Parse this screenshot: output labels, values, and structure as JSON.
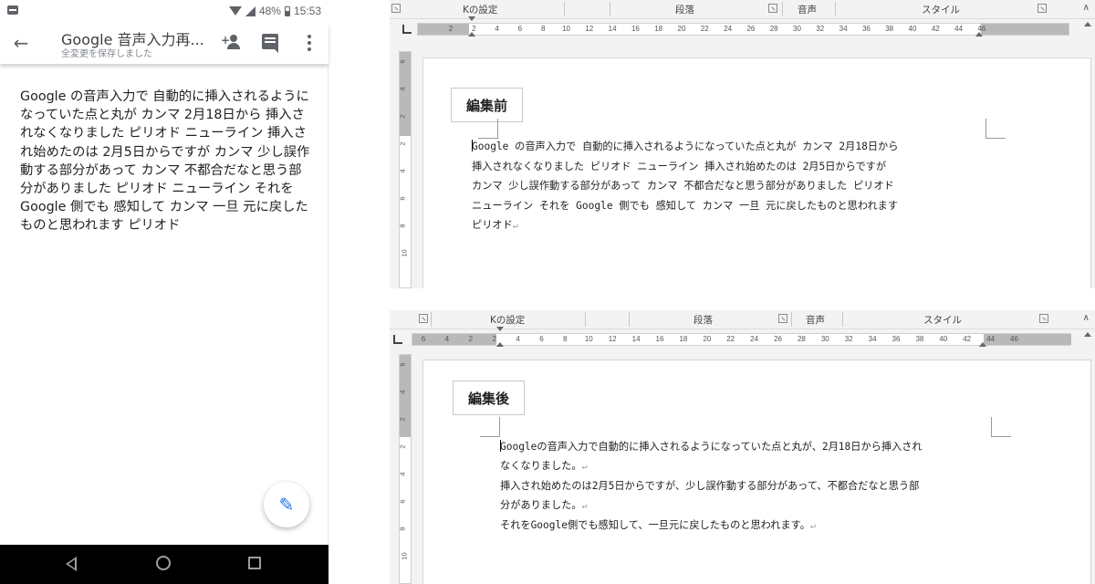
{
  "phone": {
    "status": {
      "battery": "48%",
      "time": "15:53"
    },
    "appbar": {
      "back_icon": "arrow-back-icon",
      "title": "Google 音声入力再...",
      "subtitle": "全変更を保存しました",
      "actions": [
        "person-add-icon",
        "comment-icon",
        "more-vert-icon"
      ]
    },
    "body_text": "Google の音声入力で 自動的に挿入されるようになっていた点と丸が カンマ 2月18日から 挿入されなくなりました ピリオド ニューライン 挿入され始めたのは 2月5日からですが カンマ 少し誤作動する部分があって カンマ 不都合だなと思う部分がありました ピリオド ニューライン それを Google 側でも 感知して カンマ 一旦 元に戻したものと思われます ピリオド",
    "fab_icon": "edit-pencil-icon",
    "navbar": [
      "nav-back-icon",
      "nav-home-icon",
      "nav-recent-icon"
    ],
    "accent_color": "#1a73e8"
  },
  "word_top": {
    "ribbon": {
      "group1": "Kの設定",
      "group2": "段落",
      "group3": "音声",
      "group4": "スタイル"
    },
    "ruler_ticks": [
      "2",
      "2",
      "4",
      "6",
      "8",
      "10",
      "12",
      "14",
      "16",
      "18",
      "20",
      "22",
      "24",
      "26",
      "28",
      "30",
      "32",
      "34",
      "36",
      "38",
      "40",
      "42",
      "44",
      "46"
    ],
    "vruler_ticks": [
      "6",
      "4",
      "2",
      "2",
      "4",
      "6",
      "8",
      "10"
    ],
    "label": "編集前",
    "lines": [
      "Google の音声入力で 自動的に挿入されるようになっていた点と丸が カンマ 2月18日から",
      "挿入されなくなりました ピリオド ニューライン 挿入され始めたのは 2月5日からですが",
      "カンマ 少し誤作動する部分があって カンマ 不都合だなと思う部分がありました ピリオド",
      "ニューライン それを Google 側でも 感知して カンマ 一旦 元に戻したものと思われます",
      "ピリオド"
    ],
    "para_mark": "↵"
  },
  "word_bottom": {
    "ribbon": {
      "group1": "Kの設定",
      "group2": "段落",
      "group3": "音声",
      "group4": "スタイル"
    },
    "ruler_ticks": [
      "6",
      "4",
      "2",
      "2",
      "4",
      "6",
      "8",
      "10",
      "12",
      "14",
      "16",
      "18",
      "20",
      "22",
      "24",
      "26",
      "28",
      "30",
      "32",
      "34",
      "36",
      "38",
      "40",
      "42",
      "44",
      "46"
    ],
    "vruler_ticks": [
      "6",
      "4",
      "2",
      "2",
      "4",
      "6",
      "8",
      "10"
    ],
    "label": "編集後",
    "lines": [
      "Googleの音声入力で自動的に挿入されるようになっていた点と丸が、2月18日から挿入され",
      "なくなりました。",
      "挿入され始めたのは2月5日からですが、少し誤作動する部分があって、不都合だなと思う部",
      "分がありました。",
      "それをGoogle側でも感知して、一旦元に戻したものと思われます。"
    ],
    "para_mark": "↵"
  }
}
